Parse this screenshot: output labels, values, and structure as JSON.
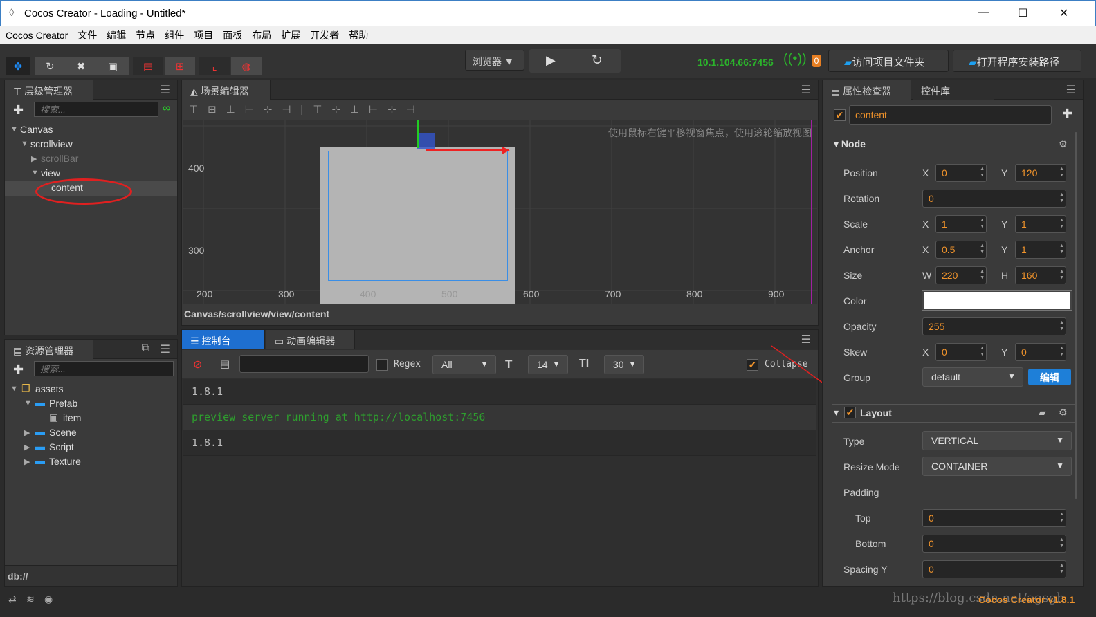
{
  "window": {
    "title": "Cocos Creator - Loading - Untitled*",
    "minimize": "—",
    "maximize": "☐",
    "close": "✕"
  },
  "menu": [
    "Cocos Creator",
    "文件",
    "编辑",
    "节点",
    "组件",
    "项目",
    "面板",
    "布局",
    "扩展",
    "开发者",
    "帮助"
  ],
  "toolbar": {
    "platform": "浏览器",
    "ip": "10.1.104.66:7456",
    "badge": "0",
    "open_project_folder": "访问项目文件夹",
    "open_install_path": "打开程序安装路径",
    "accent": "#1ea0f0"
  },
  "hierarchy": {
    "title": "层级管理器",
    "search_placeholder": "搜索...",
    "nodes": [
      {
        "label": "Canvas",
        "depth": 0,
        "arrow": "▼"
      },
      {
        "label": "scrollview",
        "depth": 1,
        "arrow": "▼"
      },
      {
        "label": "scrollBar",
        "depth": 2,
        "arrow": "▶",
        "dim": true
      },
      {
        "label": "view",
        "depth": 2,
        "arrow": "▼"
      },
      {
        "label": "content",
        "depth": 3,
        "arrow": "",
        "selected": true
      }
    ]
  },
  "assets": {
    "title": "资源管理器",
    "search_placeholder": "搜索...",
    "footer": "db://",
    "items": [
      {
        "label": "assets",
        "depth": 0,
        "arrow": "▼",
        "icon": "assets-icon"
      },
      {
        "label": "Prefab",
        "depth": 1,
        "arrow": "▼",
        "icon": "folder-icon"
      },
      {
        "label": "item",
        "depth": 2,
        "arrow": "",
        "icon": "prefab-icon"
      },
      {
        "label": "Scene",
        "depth": 1,
        "arrow": "▶",
        "icon": "folder-icon"
      },
      {
        "label": "Script",
        "depth": 1,
        "arrow": "▶",
        "icon": "folder-icon"
      },
      {
        "label": "Texture",
        "depth": 1,
        "arrow": "▶",
        "icon": "folder-icon"
      }
    ]
  },
  "scene": {
    "title": "场景编辑器",
    "hint": "使用鼠标右键平移视窗焦点，使用滚轮缩放视图",
    "y_ticks": [
      "400",
      "300"
    ],
    "x_ticks": [
      "200",
      "300",
      "400",
      "500",
      "600",
      "700",
      "800",
      "900"
    ],
    "breadcrumb": "Canvas/scrollview/view/content"
  },
  "console": {
    "tabs": [
      "控制台",
      "动画编辑器"
    ],
    "regex_label": "Regex",
    "filter": "All",
    "font_size": "14",
    "line_height": "30",
    "collapse_label": "Collapse",
    "logs": [
      {
        "text": "1.8.1",
        "color": "#bbbbbb"
      },
      {
        "text": "preview server running at http://localhost:7456",
        "color": "#2e9e2e"
      },
      {
        "text": "1.8.1",
        "color": "#bbbbbb"
      }
    ]
  },
  "inspector": {
    "tabs": [
      "属性检查器",
      "控件库"
    ],
    "node_name": "content",
    "node_section": "Node",
    "props": {
      "position": {
        "label": "Position",
        "x": "0",
        "y": "120"
      },
      "rotation": {
        "label": "Rotation",
        "value": "0"
      },
      "scale": {
        "label": "Scale",
        "x": "1",
        "y": "1"
      },
      "anchor": {
        "label": "Anchor",
        "x": "0.5",
        "y": "1"
      },
      "size": {
        "label": "Size",
        "w": "220",
        "h": "160"
      },
      "color": {
        "label": "Color",
        "value": "#ffffff"
      },
      "opacity": {
        "label": "Opacity",
        "value": "255"
      },
      "skew": {
        "label": "Skew",
        "x": "0",
        "y": "0"
      },
      "group": {
        "label": "Group",
        "value": "default",
        "edit": "编辑"
      }
    },
    "layout_section": "Layout",
    "layout": {
      "type": {
        "label": "Type",
        "value": "VERTICAL"
      },
      "resize": {
        "label": "Resize Mode",
        "value": "CONTAINER"
      },
      "padding": "Padding",
      "top": {
        "label": "Top",
        "value": "0"
      },
      "bottom": {
        "label": "Bottom",
        "value": "0"
      },
      "spacing": {
        "label": "Spacing Y",
        "value": "0"
      }
    },
    "axis": {
      "x": "X",
      "y": "Y",
      "w": "W",
      "h": "H"
    }
  },
  "status": {
    "version": "Cocos Creator v1.8.1",
    "watermark": "https://blog.csdn.net/agsgh"
  }
}
